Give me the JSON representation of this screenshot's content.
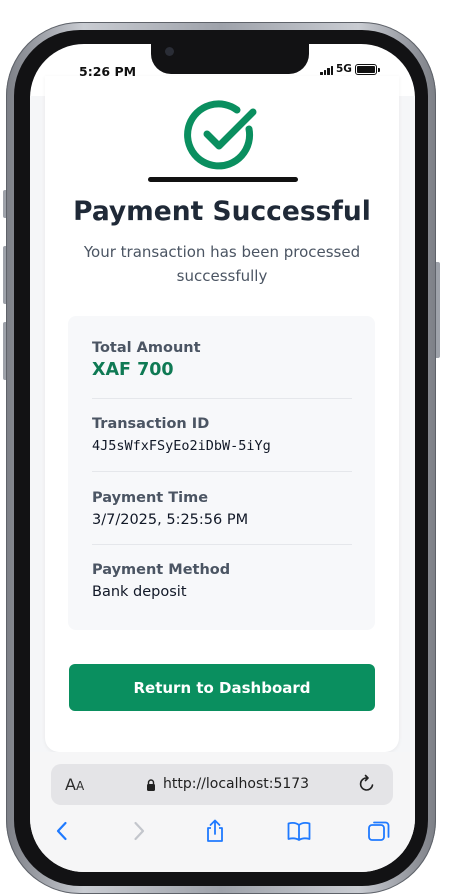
{
  "status_bar": {
    "time": "5:26 PM",
    "network": "5G"
  },
  "payment": {
    "title": "Payment Successful",
    "subtitle": "Your transaction has been processed successfully",
    "details": [
      {
        "label": "Total Amount",
        "value": "XAF 700"
      },
      {
        "label": "Transaction ID",
        "value": "4J5sWfxFSyEo2iDbW-5iYg"
      },
      {
        "label": "Payment Time",
        "value": "3/7/2025, 5:25:56 PM"
      },
      {
        "label": "Payment Method",
        "value": "Bank deposit"
      }
    ],
    "return_button": "Return to Dashboard"
  },
  "browser": {
    "text_size_label_large": "A",
    "text_size_label_small": "A",
    "url": "http://localhost:5173",
    "toolbar_icons": [
      "back-icon",
      "forward-icon",
      "share-icon",
      "bookmarks-icon",
      "tabs-icon"
    ]
  },
  "colors": {
    "success_green": "#0a8f5f",
    "amount_green": "#0f7a54",
    "title": "#1f2937"
  }
}
